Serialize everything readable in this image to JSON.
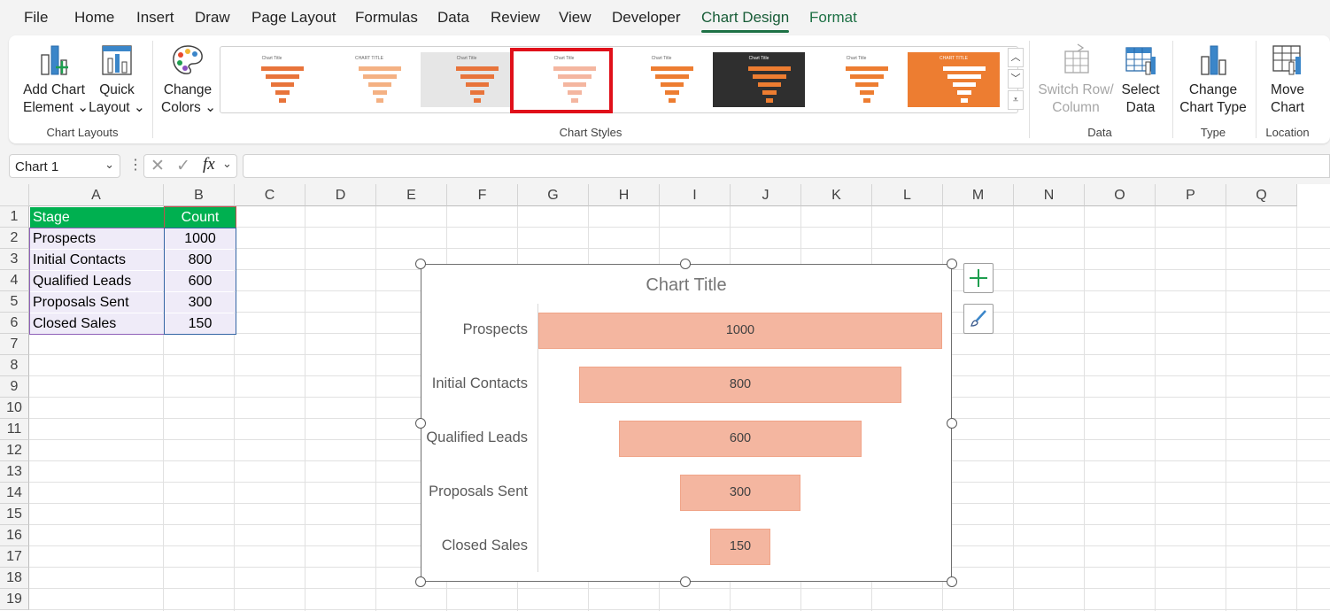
{
  "menu": {
    "items": [
      "File",
      "Home",
      "Insert",
      "Draw",
      "Page Layout",
      "Formulas",
      "Data",
      "Review",
      "View",
      "Developer",
      "Chart Design",
      "Format"
    ]
  },
  "ribbon": {
    "add_chart_element": [
      "Add Chart",
      "Element ⌄"
    ],
    "quick_layout": [
      "Quick",
      "Layout ⌄"
    ],
    "change_colors": [
      "Change",
      "Colors ⌄"
    ],
    "switch_row_column": [
      "Switch Row/",
      "Column"
    ],
    "select_data": [
      "Select",
      "Data"
    ],
    "change_chart_type": [
      "Change",
      "Chart Type"
    ],
    "move_chart": [
      "Move",
      "Chart"
    ],
    "groups": {
      "chart_layouts": "Chart Layouts",
      "chart_styles": "Chart Styles",
      "data": "Data",
      "type": "Type",
      "location": "Location"
    },
    "style_thumbs": [
      {
        "title": "Chart Title",
        "bg": "#ffffff",
        "bar": "#e8743b"
      },
      {
        "title": "CHART TITLE",
        "bg": "#ffffff",
        "bar": "#f4b183"
      },
      {
        "title": "Chart Title",
        "bg": "#e6e6e6",
        "bar": "#e8743b"
      },
      {
        "title": "Chart Title",
        "bg": "#ffffff",
        "bar": "#f4b6a0"
      },
      {
        "title": "Chart Title",
        "bg": "#ffffff",
        "bar": "#ed7d31"
      },
      {
        "title": "Chart Title",
        "bg": "#2f2f2f",
        "bar": "#ed7d31"
      },
      {
        "title": "Chart Title",
        "bg": "#ffffff",
        "bar": "#ed7d31"
      },
      {
        "title": "CHART TITLE",
        "bg": "#ed7d31",
        "bar": "#ffffff"
      }
    ]
  },
  "formula_bar": {
    "name_box": "Chart 1",
    "formula": ""
  },
  "sheet": {
    "columns": [
      "A",
      "B",
      "C",
      "D",
      "E",
      "F",
      "G",
      "H",
      "I",
      "J",
      "K",
      "L",
      "M",
      "N",
      "O",
      "P",
      "Q"
    ],
    "rows": [
      "1",
      "2",
      "3",
      "4",
      "5",
      "6",
      "7",
      "8",
      "9",
      "10",
      "11",
      "12",
      "13",
      "14",
      "15",
      "16",
      "17",
      "18",
      "19"
    ],
    "header": {
      "stage": "Stage",
      "count": "Count"
    },
    "data": [
      {
        "stage": "Prospects",
        "count": "1000"
      },
      {
        "stage": "Initial Contacts",
        "count": "800"
      },
      {
        "stage": "Qualified Leads",
        "count": "600"
      },
      {
        "stage": "Proposals Sent",
        "count": "300"
      },
      {
        "stage": "Closed Sales",
        "count": "150"
      }
    ]
  },
  "colors": {
    "accent_green": "#1e7145",
    "header_fill": "#00b050",
    "data_fill": "#efebf8",
    "bar_fill": "#f4b6a0",
    "selection_red": "#e0101a"
  },
  "chart_data": {
    "type": "bar",
    "subtype": "funnel",
    "title": "Chart Title",
    "categories": [
      "Prospects",
      "Initial Contacts",
      "Qualified Leads",
      "Proposals Sent",
      "Closed Sales"
    ],
    "values": [
      1000,
      800,
      600,
      300,
      150
    ],
    "data_labels": [
      "1000",
      "800",
      "600",
      "300",
      "150"
    ],
    "xlabel": "",
    "ylabel": "",
    "grid": false,
    "legend": "none"
  }
}
